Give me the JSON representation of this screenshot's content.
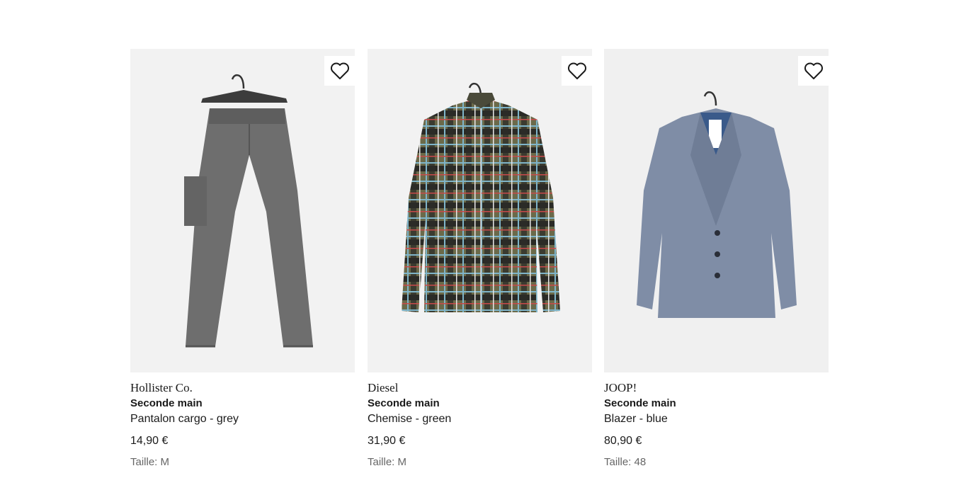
{
  "products": [
    {
      "brand": "Hollister Co.",
      "condition": "Seconde main",
      "name": "Pantalon cargo - grey",
      "price": "14,90 €",
      "size": "Taille: M",
      "image_icon": "grey-cargo-pants-on-hanger",
      "wishlist_icon": "heart-outline-icon"
    },
    {
      "brand": "Diesel",
      "condition": "Seconde main",
      "name": "Chemise - green",
      "price": "31,90 €",
      "size": "Taille: M",
      "image_icon": "plaid-shirt-on-hanger",
      "wishlist_icon": "heart-outline-icon"
    },
    {
      "brand": "JOOP!",
      "condition": "Seconde main",
      "name": "Blazer - blue",
      "price": "80,90 €",
      "size": "Taille: 48",
      "image_icon": "blue-blazer-on-hanger",
      "wishlist_icon": "heart-outline-icon"
    }
  ]
}
